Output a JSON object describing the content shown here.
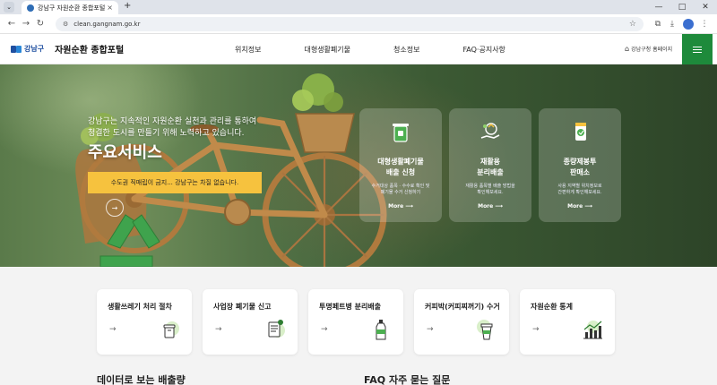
{
  "browser": {
    "tab_title": "강남구 자원순환 종합포털",
    "tab_close": "×",
    "new_tab": "+",
    "url": "clean.gangnam.go.kr",
    "window_controls": [
      "—",
      "□",
      "✕"
    ]
  },
  "header": {
    "logo_city": "강남구",
    "site_title": "자원순환 종합포털",
    "nav": [
      "위치정보",
      "대형생활폐기물",
      "청소정보",
      "FAQ·공지사항"
    ],
    "home_link": "강남구청 홈페이지"
  },
  "hero": {
    "intro_line1": "강남구는 지속적인 자원순환 실천과 관리를 통하여",
    "intro_line2": "청결한 도시를 만들기 위해 노력하고 있습니다.",
    "title": "주요서비스",
    "notice": "수도권 직매립이 금지... 강남구는 차질 없습니다.",
    "services": [
      {
        "title1": "대형생활폐기물",
        "title2": "배출 신청",
        "desc1": "수거대상 품목 · 수수료 확인 및",
        "desc2": "폐기물 수거 신청하기",
        "more": "More ⟶"
      },
      {
        "title1": "재활용",
        "title2": "분리배출",
        "desc1": "재활용 품목별 배출 방법을",
        "desc2": "확인해보세요.",
        "more": "More ⟶"
      },
      {
        "title1": "종량제봉투",
        "title2": "판매소",
        "desc1": "사용 지역별 위치정보로",
        "desc2": "간편하게 확인해보세요.",
        "more": "More ⟶"
      }
    ]
  },
  "quick_menu": [
    {
      "label": "생활쓰레기 처리 절차"
    },
    {
      "label": "사업장 폐기물 신고"
    },
    {
      "label": "투명페트병 분리배출"
    },
    {
      "label": "커피박(커피찌꺼기) 수거"
    },
    {
      "label": "자원순환 통계"
    }
  ],
  "sections": {
    "data_title": "데이터로 보는 배출량",
    "faq_title": "FAQ 자주 묻는 질문"
  },
  "colors": {
    "accent_green": "#1e8a3b",
    "notice_yellow": "#f6c23e",
    "brand_blue": "#1f4fa0"
  }
}
